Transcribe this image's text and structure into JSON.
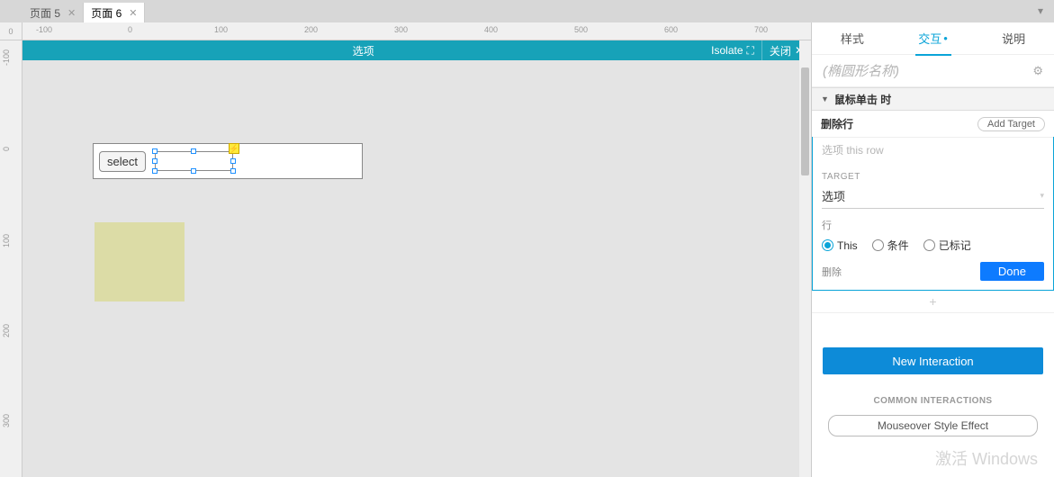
{
  "tabs": {
    "page5": "页面 5",
    "page6": "页面 6"
  },
  "ruler_corner": "0",
  "ruler_h": {
    "m100": "-100",
    "p0": "0",
    "p100": "100",
    "p200": "200",
    "p300": "300",
    "p400": "400",
    "p500": "500",
    "p600": "600",
    "p700": "700"
  },
  "ruler_v": {
    "m100": "-100",
    "p0": "0",
    "p100": "100",
    "p200": "200",
    "p300": "300"
  },
  "edit_bar": {
    "title": "选项",
    "isolate": "Isolate",
    "close": "关闭"
  },
  "canvas": {
    "select_btn": "select"
  },
  "inspector": {
    "tabs": {
      "style": "样式",
      "interact": "交互",
      "interact_dot": "•",
      "notes": "说明"
    },
    "shape_name_placeholder": "(椭圆形名称)",
    "event_title": "鼠标单击 时",
    "action_name": "删除行",
    "add_target": "Add Target",
    "hint": "选项 this row",
    "target_label": "TARGET",
    "target_value": "选项",
    "row_label": "行",
    "radios": {
      "this": "This",
      "cond": "条件",
      "marked": "已标记"
    },
    "delete": "删除",
    "done": "Done",
    "new_interaction": "New Interaction",
    "common": "COMMON INTERACTIONS",
    "mouseover": "Mouseover Style Effect"
  },
  "watermark": "激活 Windows"
}
